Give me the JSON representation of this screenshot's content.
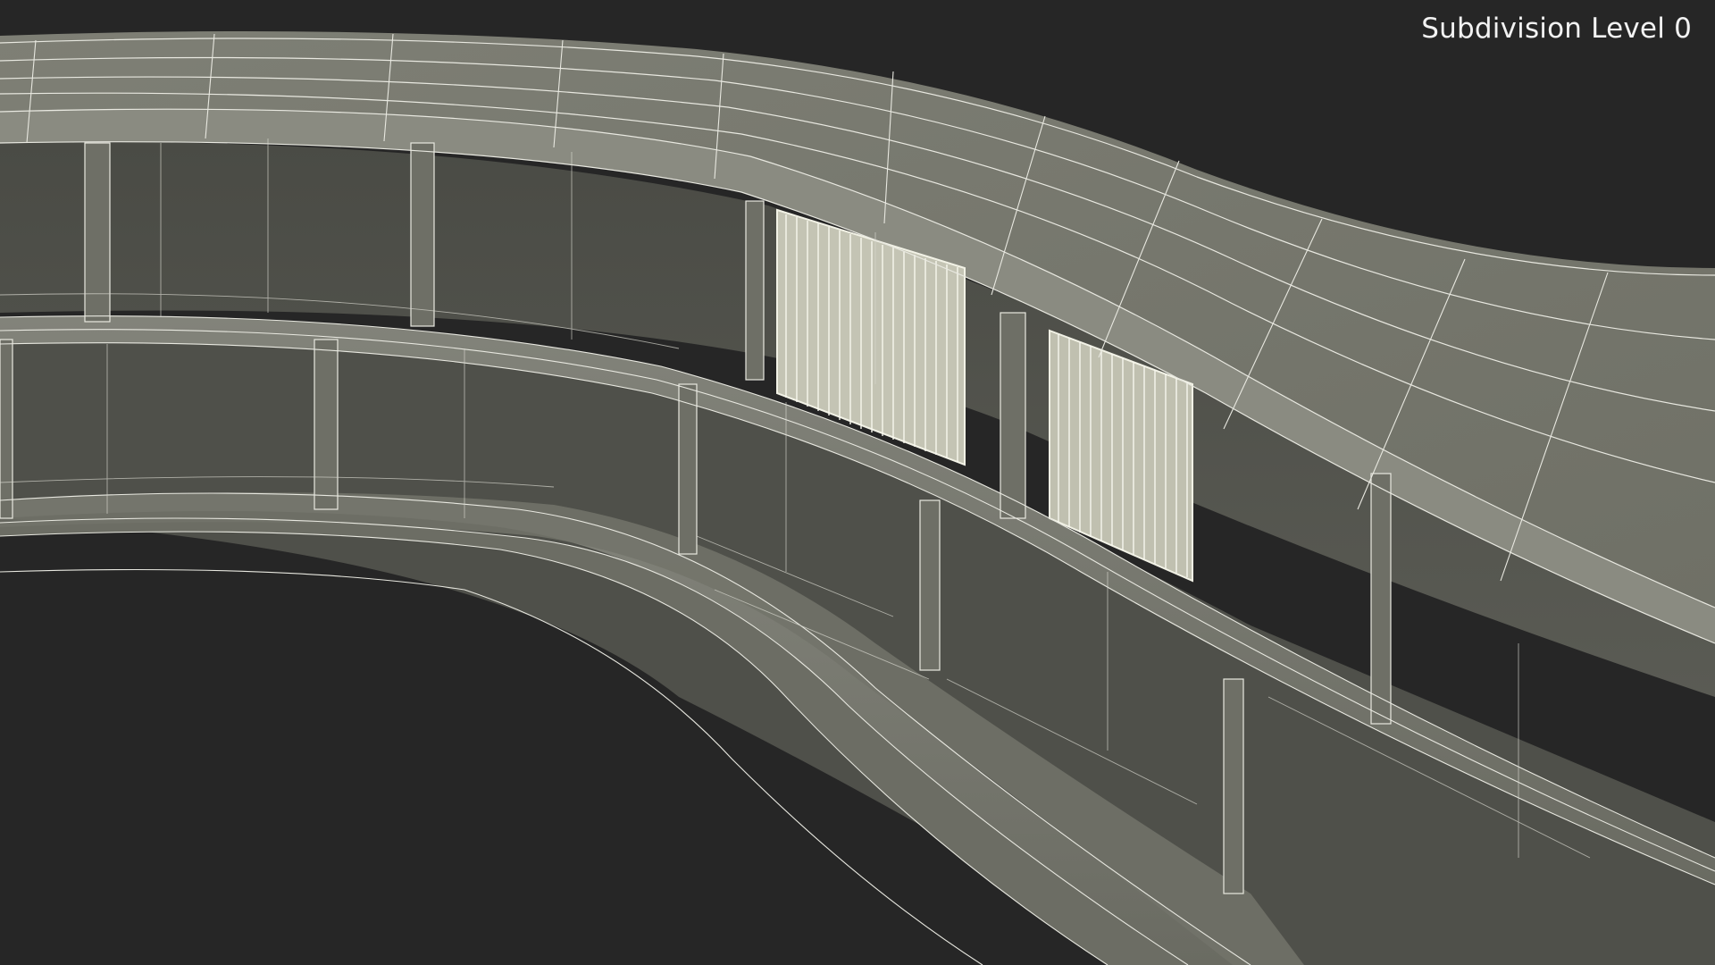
{
  "viewport": {
    "overlay_label": "Subdivision Level 0",
    "background_color": "#262626",
    "model_color": "#7c7d73",
    "wire_color": "#e8e8e0",
    "subject": "curved multi-level building structure wireframe"
  }
}
